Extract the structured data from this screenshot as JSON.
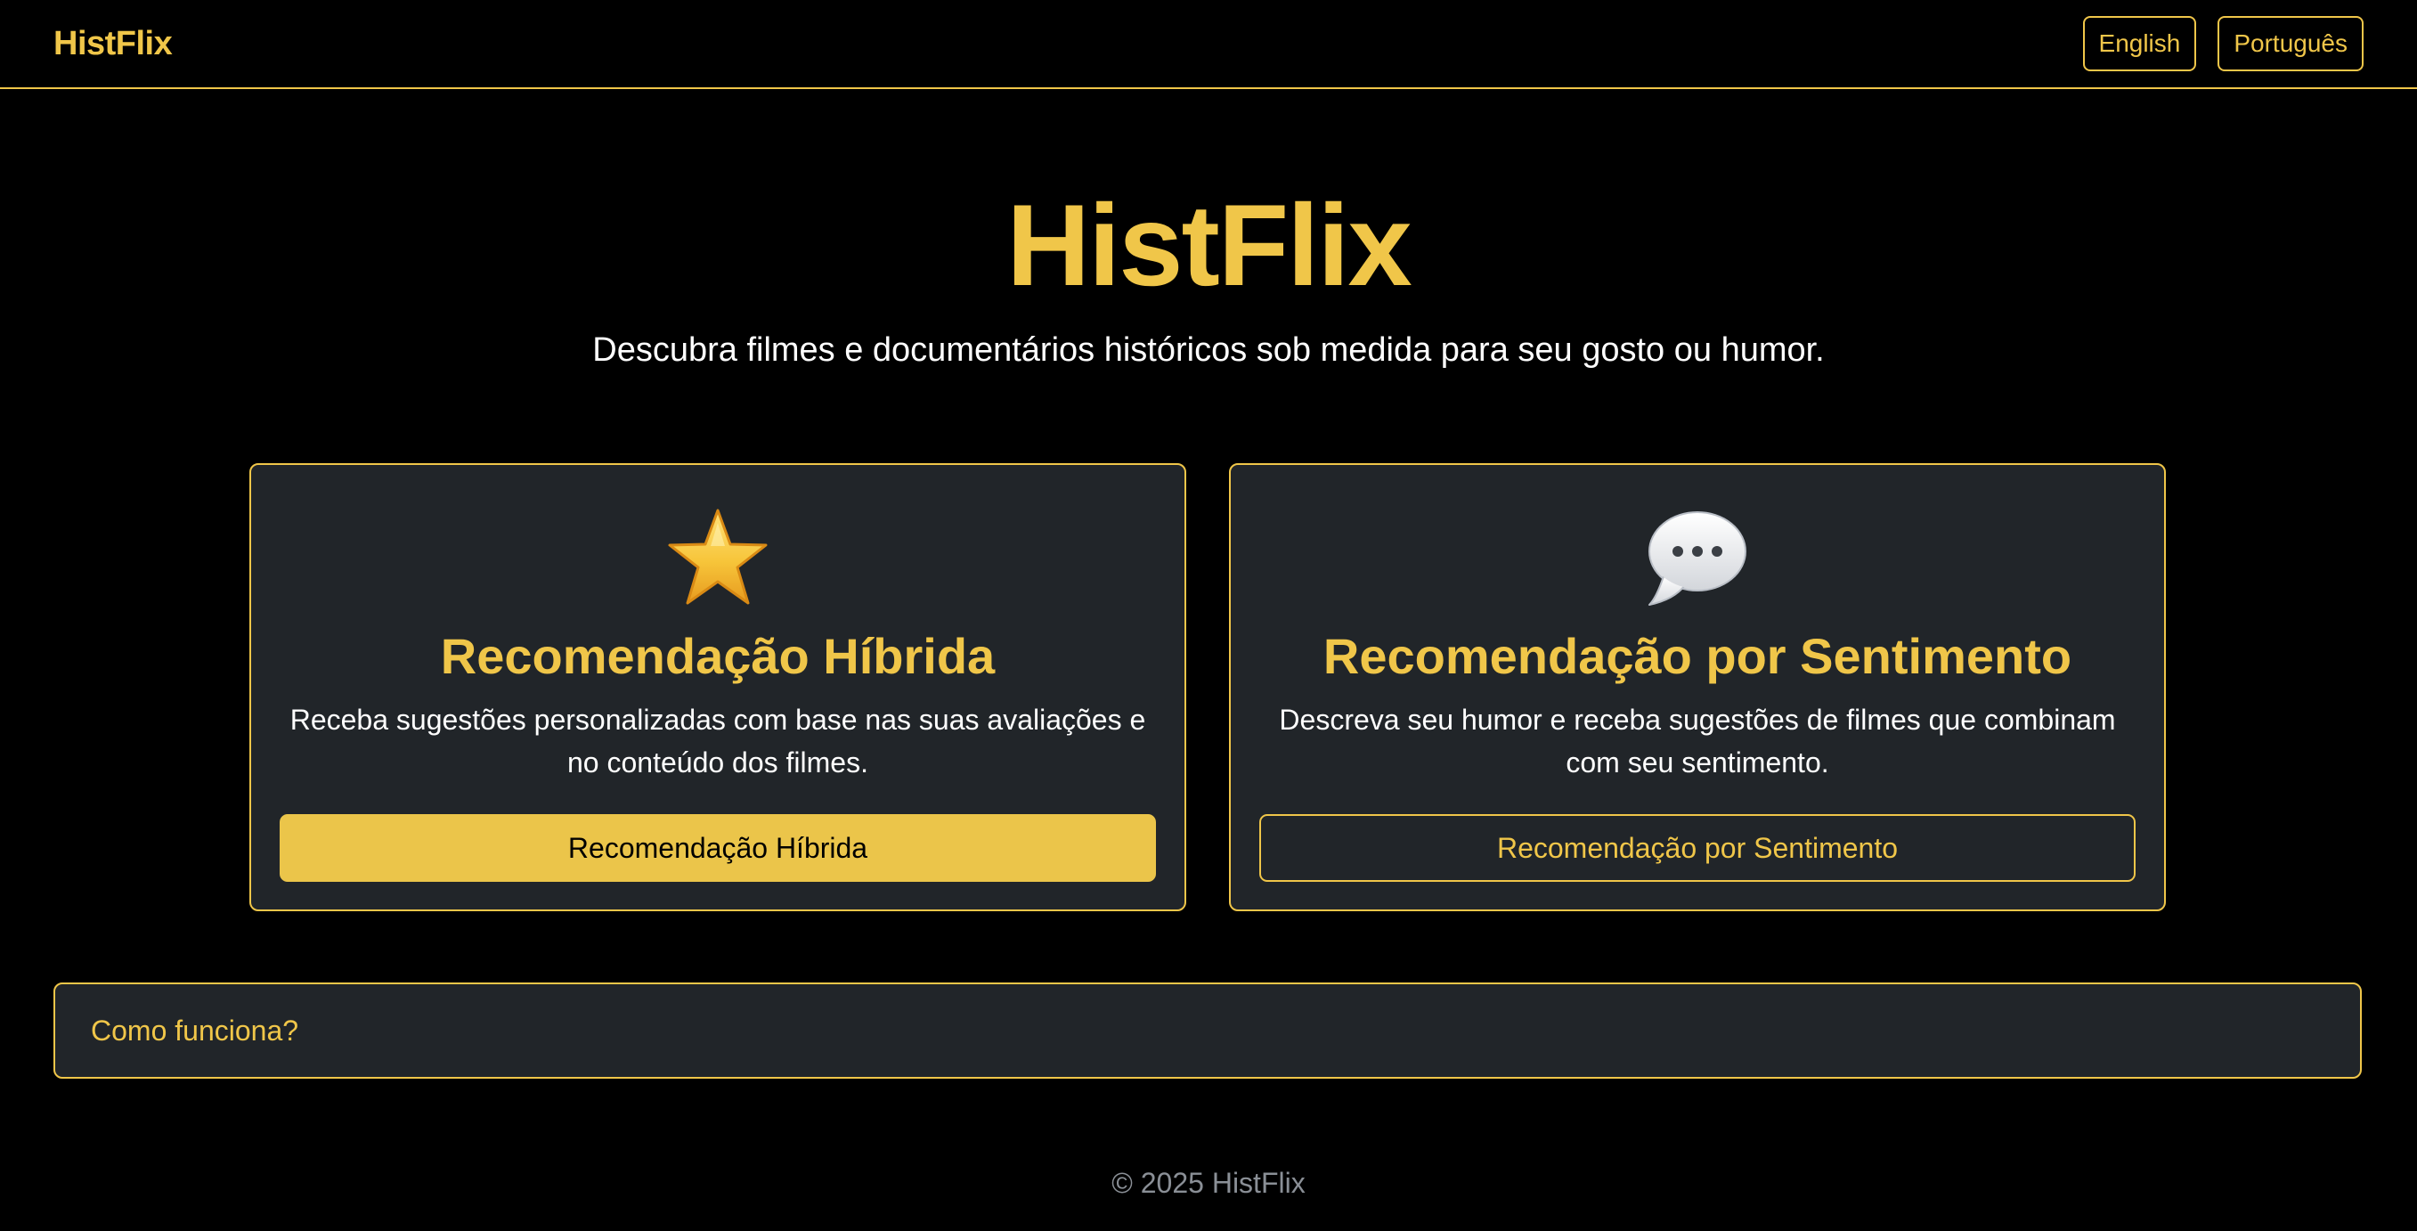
{
  "nav": {
    "brand": "HistFlix",
    "languages": [
      "English",
      "Português"
    ]
  },
  "hero": {
    "title": "HistFlix",
    "subtitle": "Descubra filmes e documentários históricos sob medida para seu gosto ou humor."
  },
  "cards": [
    {
      "icon": "star-icon",
      "title": "Recomendação Híbrida",
      "description": "Receba sugestões personalizadas com base nas suas avaliações e no conteúdo dos filmes.",
      "button": "Recomendação Híbrida"
    },
    {
      "icon": "speech-bubble-icon",
      "title": "Recomendação por Sentimento",
      "description": "Descreva seu humor e receba sugestões de filmes que combinam com seu sentimento.",
      "button": "Recomendação por Sentimento"
    }
  ],
  "accordion": {
    "label": "Como funciona?"
  },
  "footer": {
    "text": "© 2025 HistFlix"
  },
  "colors": {
    "accent": "#f0c649",
    "card_bg": "#212529",
    "background": "#000000",
    "footer_text": "#8a8f96"
  }
}
